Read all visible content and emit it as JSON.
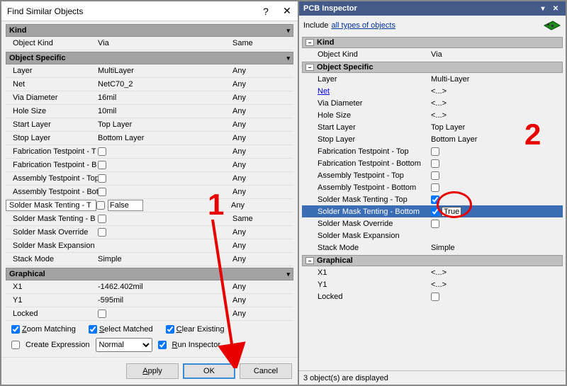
{
  "dialog": {
    "title": "Find Similar Objects",
    "help": "?",
    "close": "✕",
    "sections": {
      "kind": {
        "header": "Kind",
        "rows": [
          {
            "label": "Object Kind",
            "value": "Via",
            "match": "Same"
          }
        ]
      },
      "obj": {
        "header": "Object Specific",
        "rows": [
          {
            "label": "Layer",
            "value": "MultiLayer",
            "match": "Any"
          },
          {
            "label": "Net",
            "value": "NetC70_2",
            "match": "Any"
          },
          {
            "label": "Via Diameter",
            "value": "16mil",
            "match": "Any"
          },
          {
            "label": "Hole Size",
            "value": "10mil",
            "match": "Any"
          },
          {
            "label": "Start Layer",
            "value": "Top Layer",
            "match": "Any"
          },
          {
            "label": "Stop Layer",
            "value": "Bottom Layer",
            "match": "Any"
          },
          {
            "label": "Fabrication Testpoint - T",
            "value": "",
            "match": "Any",
            "chk": false
          },
          {
            "label": "Fabrication Testpoint - B",
            "value": "",
            "match": "Any",
            "chk": false
          },
          {
            "label": "Assembly Testpoint - Top",
            "value": "",
            "match": "Any",
            "chk": false
          },
          {
            "label": "Assembly Testpoint - Bot",
            "value": "",
            "match": "Any",
            "chk": false
          },
          {
            "label": "Solder Mask Tenting - T",
            "value": "False",
            "match": "Any",
            "chk": false,
            "editing": true
          },
          {
            "label": "Solder Mask Tenting - B",
            "value": "",
            "match": "Same",
            "chk": false
          },
          {
            "label": "Solder Mask Override",
            "value": "",
            "match": "Any",
            "chk": false
          },
          {
            "label": "Solder Mask Expansion",
            "value": "",
            "match": "Any"
          },
          {
            "label": "Stack Mode",
            "value": "Simple",
            "match": "Any"
          }
        ]
      },
      "gfx": {
        "header": "Graphical",
        "rows": [
          {
            "label": "X1",
            "value": "-1462.402mil",
            "match": "Any"
          },
          {
            "label": "Y1",
            "value": "-595mil",
            "match": "Any"
          },
          {
            "label": "Locked",
            "value": "",
            "match": "Any",
            "chk": false
          }
        ]
      }
    },
    "options": {
      "zoom": "Zoom Matching",
      "select": "Select Matched",
      "clear": "Clear Existing",
      "expr": "Create Expression",
      "mask": "Normal",
      "run": "Run Inspector"
    },
    "buttons": {
      "apply": "Apply",
      "ok": "OK",
      "cancel": "Cancel"
    }
  },
  "inspector": {
    "title": "PCB Inspector",
    "include_label": "Include",
    "include_link": "all types of objects",
    "sections": {
      "kind": {
        "header": "Kind",
        "rows": [
          {
            "label": "Object Kind",
            "value": "Via"
          }
        ]
      },
      "obj": {
        "header": "Object Specific",
        "rows": [
          {
            "label": "Layer",
            "value": "Multi-Layer"
          },
          {
            "label": "Net",
            "value": "<...>",
            "link": true,
            "label_link": true
          },
          {
            "label": "Via Diameter",
            "value": "<...>"
          },
          {
            "label": "Hole Size",
            "value": "<...>"
          },
          {
            "label": "Start Layer",
            "value": "Top Layer"
          },
          {
            "label": "Stop Layer",
            "value": "Bottom Layer"
          },
          {
            "label": "Fabrication Testpoint - Top",
            "chk": false
          },
          {
            "label": "Fabrication Testpoint - Bottom",
            "chk": false
          },
          {
            "label": "Assembly Testpoint - Top",
            "chk": false
          },
          {
            "label": "Assembly Testpoint - Bottom",
            "chk": false
          },
          {
            "label": "Solder Mask Tenting - Top",
            "chk": true
          },
          {
            "label": "Solder Mask Tenting - Bottom",
            "chk": true,
            "value": "True",
            "selected": true
          },
          {
            "label": "Solder Mask Override",
            "chk": false
          },
          {
            "label": "Solder Mask Expansion",
            "value": ""
          },
          {
            "label": "Stack Mode",
            "value": "Simple"
          }
        ]
      },
      "gfx": {
        "header": "Graphical",
        "rows": [
          {
            "label": "X1",
            "value": "<...>"
          },
          {
            "label": "Y1",
            "value": "<...>"
          },
          {
            "label": "Locked",
            "chk": false
          }
        ]
      }
    },
    "footer": "3 object(s) are displayed"
  },
  "annotations": {
    "one": "1",
    "two": "2"
  }
}
